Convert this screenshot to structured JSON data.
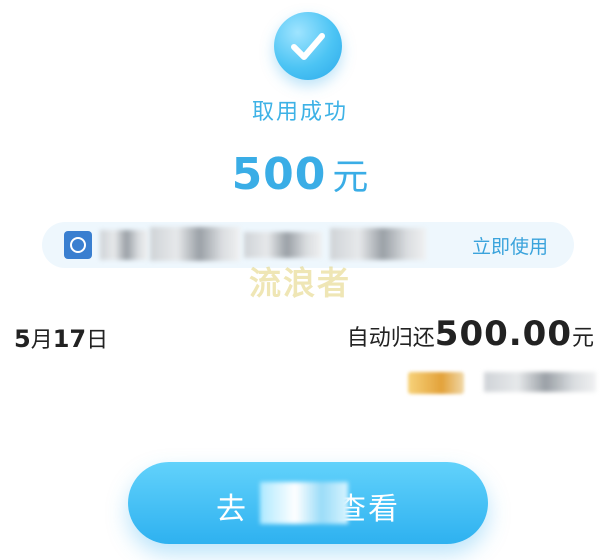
{
  "status": {
    "icon": "check-circle-icon",
    "title": "取用成功"
  },
  "amount": {
    "value": "500",
    "unit": "元"
  },
  "coupon": {
    "icon": "coupon-logo-icon",
    "use_label": "立即使用"
  },
  "watermark": "流浪者",
  "repayment": {
    "month": "5",
    "month_unit": "月",
    "day": "17",
    "day_unit": "日",
    "label": "自动归还",
    "amount": "500.00",
    "unit": "元"
  },
  "cta": {
    "label_start": "去",
    "label_end": "查看"
  },
  "colors": {
    "accent": "#3aade6",
    "button_top": "#62d2fb",
    "button_bottom": "#2eb1f0"
  }
}
